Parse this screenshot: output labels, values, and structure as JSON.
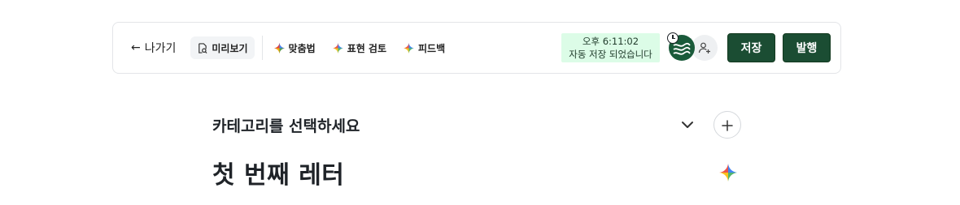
{
  "toolbar": {
    "back_label": "나가기",
    "back_icon": "←",
    "preview_label": "미리보기",
    "ai_tools": [
      {
        "label": "맞춤법",
        "icon": "sparkle-icon"
      },
      {
        "label": "표현 검토",
        "icon": "sparkle-icon"
      },
      {
        "label": "피드백",
        "icon": "sparkle-icon"
      }
    ],
    "autosave_time": "오후 6:11:02",
    "autosave_text": "자동 저장 되었습니다",
    "save_label": "저장",
    "publish_label": "발행"
  },
  "editor": {
    "category_placeholder": "카테고리를 선택하세요",
    "title": "첫 번째 레터"
  },
  "colors": {
    "primary_button": "#1b4d33",
    "autosave_bg": "#dcfce7",
    "avatar_bg": "#1a5a3a"
  }
}
